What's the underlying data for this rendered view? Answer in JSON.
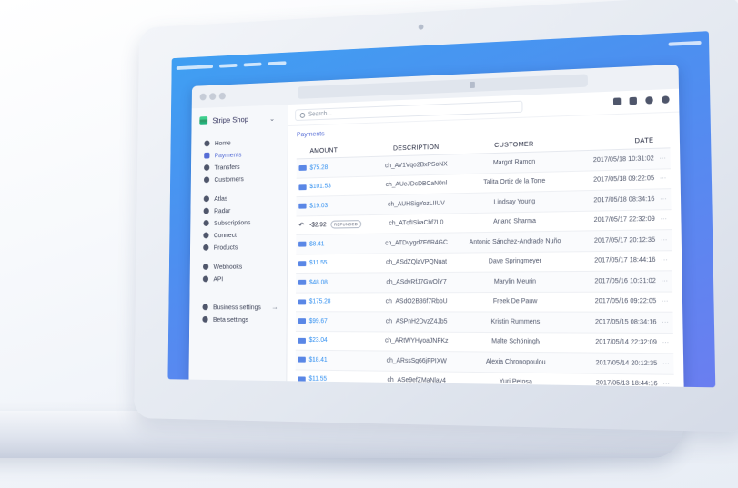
{
  "app": {
    "brand": "Stripe Shop",
    "search_placeholder": "Search...",
    "breadcrumb": "Payments"
  },
  "sidebar": {
    "items": [
      {
        "label": "Home",
        "icon": "home-icon"
      },
      {
        "label": "Payments",
        "icon": "payments-icon",
        "active": true
      },
      {
        "label": "Transfers",
        "icon": "transfers-icon"
      },
      {
        "label": "Customers",
        "icon": "customers-icon"
      }
    ],
    "products": [
      {
        "label": "Atlas",
        "icon": "atlas-icon"
      },
      {
        "label": "Radar",
        "icon": "radar-icon"
      },
      {
        "label": "Subscriptions",
        "icon": "subscriptions-icon"
      },
      {
        "label": "Connect",
        "icon": "connect-icon"
      },
      {
        "label": "Products",
        "icon": "products-icon"
      }
    ],
    "dev": [
      {
        "label": "Webhooks",
        "icon": "webhooks-icon"
      },
      {
        "label": "API",
        "icon": "api-icon"
      }
    ],
    "settings": [
      {
        "label": "Business settings",
        "icon": "business-settings-icon"
      },
      {
        "label": "Beta settings",
        "icon": "beta-settings-icon"
      }
    ]
  },
  "table": {
    "headers": {
      "amount": "AMOUNT",
      "description": "DESCRIPTION",
      "customer": "CUSTOMER",
      "date": "DATE"
    },
    "more_glyph": "···",
    "refunded_label": "REFUNDED",
    "rows": [
      {
        "amount": "$75.28",
        "description": "ch_AV1Vqo2BxPSoNX",
        "customer": "Margot Ramon",
        "date": "2017/05/18 10:31:02"
      },
      {
        "amount": "$101.53",
        "description": "ch_AUeJDcDBCaN0nl",
        "customer": "Talita Ortiz de la Torre",
        "date": "2017/05/18 09:22:05"
      },
      {
        "amount": "$19.03",
        "description": "ch_AUHSigYozLIIUV",
        "customer": "Lindsay Young",
        "date": "2017/05/18 08:34:16"
      },
      {
        "amount": "-$2.92",
        "description": "ch_ATqfISkaCbf7L0",
        "customer": "Anand Sharma",
        "date": "2017/05/17 22:32:09",
        "refunded": true
      },
      {
        "amount": "$8.41",
        "description": "ch_ATDvygd7F6R4GC",
        "customer": "Antonio Sánchez-Andrade Nuño",
        "date": "2017/05/17 20:12:35"
      },
      {
        "amount": "$11.55",
        "description": "ch_ASdZQlaVPQNuat",
        "customer": "Dave Springmeyer",
        "date": "2017/05/17 18:44:16"
      },
      {
        "amount": "$48.08",
        "description": "ch_ASdvRfJ7GwOlY7",
        "customer": "Marylin Meurin",
        "date": "2017/05/16 10:31:02"
      },
      {
        "amount": "$175.28",
        "description": "ch_ASdO2B36f7RbbU",
        "customer": "Freek De Pauw",
        "date": "2017/05/16 09:22:05"
      },
      {
        "amount": "$99.67",
        "description": "ch_ASPnH2DvzZ4Jb5",
        "customer": "Kristin Rummens",
        "date": "2017/05/15 08:34:16"
      },
      {
        "amount": "$23.04",
        "description": "ch_ARtWYHyoaJNFKz",
        "customer": "Malte Schöningh",
        "date": "2017/05/14 22:32:09"
      },
      {
        "amount": "$18.41",
        "description": "ch_ARssSg66jFPIXW",
        "customer": "Alexia Chronopoulou",
        "date": "2017/05/14 20:12:35"
      },
      {
        "amount": "$11.55",
        "description": "ch_ASe9efZMaNlav4",
        "customer": "Yuri Petosa",
        "date": "2017/05/13 18:44:16"
      }
    ]
  },
  "colors": {
    "accent": "#556cd6",
    "amount": "#2f8ef0",
    "screen": "#4d8ff0"
  }
}
